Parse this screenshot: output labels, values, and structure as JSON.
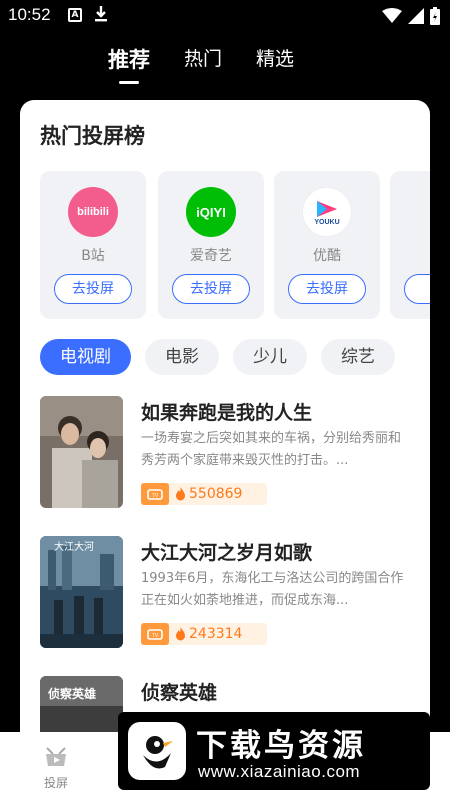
{
  "status": {
    "time": "10:52"
  },
  "tabs": [
    {
      "label": "推荐",
      "active": true
    },
    {
      "label": "热门",
      "active": false
    },
    {
      "label": "精选",
      "active": false
    }
  ],
  "section_title": "热门投屏榜",
  "platforms": [
    {
      "name": "B站",
      "logo_text": "bilibili",
      "logo_color": "#f25d8e",
      "button": "去投屏"
    },
    {
      "name": "爱奇艺",
      "logo_text": "iQIYI",
      "logo_color": "#00be06",
      "button": "去投屏"
    },
    {
      "name": "优酷",
      "logo_text": "YOUKU",
      "logo_color": "#ff3d7f",
      "button": "去投屏"
    }
  ],
  "categories": [
    {
      "label": "电视剧",
      "active": true
    },
    {
      "label": "电影",
      "active": false
    },
    {
      "label": "少儿",
      "active": false
    },
    {
      "label": "综艺",
      "active": false
    }
  ],
  "items": [
    {
      "title": "如果奔跑是我的人生",
      "desc": "一场寿宴之后突如其来的车祸，分别给秀丽和秀芳两个家庭带来毁灭性的打击。...",
      "hot": "550869"
    },
    {
      "title": "大江大河之岁月如歌",
      "desc": "1993年6月，东海化工与洛达公司的跨国合作正在如火如荼地推进，而促成东海...",
      "hot": "243314",
      "poster_text": "大江大河"
    },
    {
      "title": "侦察英雄",
      "desc": "",
      "hot": "",
      "poster_text": "侦察英雄"
    }
  ],
  "bottom_nav": {
    "label": "投屏"
  },
  "watermark": {
    "title": "下载鸟资源",
    "url": "www.xiazainiao.com"
  },
  "colors": {
    "accent": "#3b6dff",
    "hot": "#ff7a1c"
  }
}
